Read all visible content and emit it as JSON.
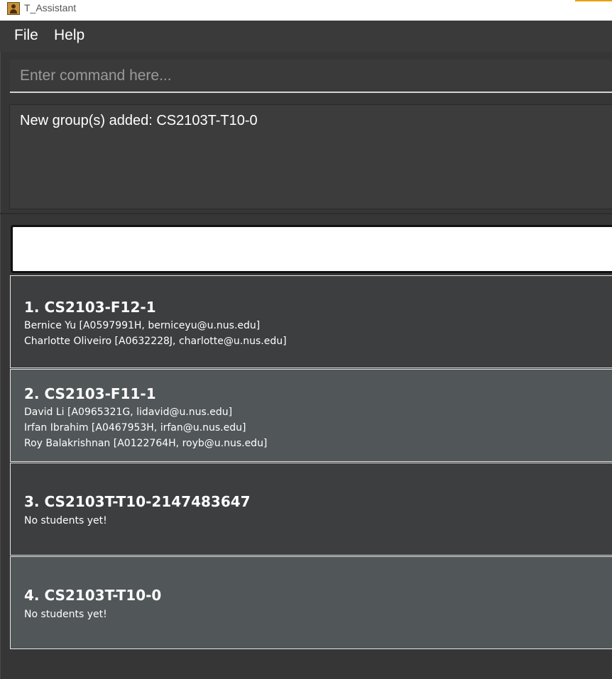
{
  "window": {
    "title": "T_Assistant"
  },
  "menu": {
    "items": [
      "File",
      "Help"
    ]
  },
  "command": {
    "placeholder": "Enter command here...",
    "value": ""
  },
  "result": {
    "text": "New group(s) added: CS2103T-T10-0"
  },
  "groups": [
    {
      "title": "1. CS2103-F12-1",
      "students": [
        "Bernice Yu [A0597991H, berniceyu@u.nus.edu]",
        "Charlotte Oliveiro [A0632228J, charlotte@u.nus.edu]"
      ]
    },
    {
      "title": "2. CS2103-F11-1",
      "students": [
        "David Li [A0965321G, lidavid@u.nus.edu]",
        "Irfan Ibrahim [A0467953H, irfan@u.nus.edu]",
        "Roy Balakrishnan [A0122764H, royb@u.nus.edu]"
      ]
    },
    {
      "title": "3. CS2103T-T10-2147483647",
      "students": [
        "No students yet!"
      ]
    },
    {
      "title": "4. CS2103T-T10-0",
      "students": [
        "No students yet!"
      ]
    }
  ]
}
